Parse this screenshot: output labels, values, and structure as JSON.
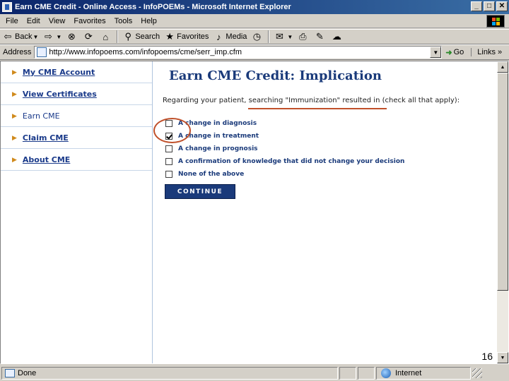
{
  "window": {
    "title": "Earn CME Credit - Online Access - InfoPOEMs - Microsoft Internet Explorer",
    "controls": [
      "_",
      "□",
      "✕"
    ]
  },
  "menu": [
    "File",
    "Edit",
    "View",
    "Favorites",
    "Tools",
    "Help"
  ],
  "toolbar": {
    "back_label": "Back",
    "search_label": "Search",
    "favorites_label": "Favorites",
    "media_label": "Media"
  },
  "address": {
    "label": "Address",
    "url": "http://www.infopoems.com/infopoems/cme/serr_imp.cfm",
    "go_label": "Go",
    "links_label": "Links »"
  },
  "sidebar": {
    "items": [
      {
        "label": "My CME Account"
      },
      {
        "label": "View Certificates"
      },
      {
        "label": "Earn CME"
      },
      {
        "label": "Claim CME"
      },
      {
        "label": "About CME"
      }
    ]
  },
  "main": {
    "title": "Earn CME Credit: Implication",
    "question": "Regarding your patient, searching \"Immunization\" resulted in (check all that apply):",
    "options": [
      {
        "label": "A change in diagnosis",
        "checked": false
      },
      {
        "label": "A change in treatment",
        "checked": true
      },
      {
        "label": "A change in prognosis",
        "checked": false
      },
      {
        "label": "A confirmation of knowledge that did not change your decision",
        "checked": false
      },
      {
        "label": "None of the above",
        "checked": false
      }
    ],
    "continue_label": "CONTINUE"
  },
  "slide_number": "16",
  "status": {
    "text": "Done",
    "zone": "Internet"
  },
  "colors": {
    "accent": "#1a3a7a",
    "annotation": "#c0502a",
    "titlebar": "#0a246a"
  }
}
